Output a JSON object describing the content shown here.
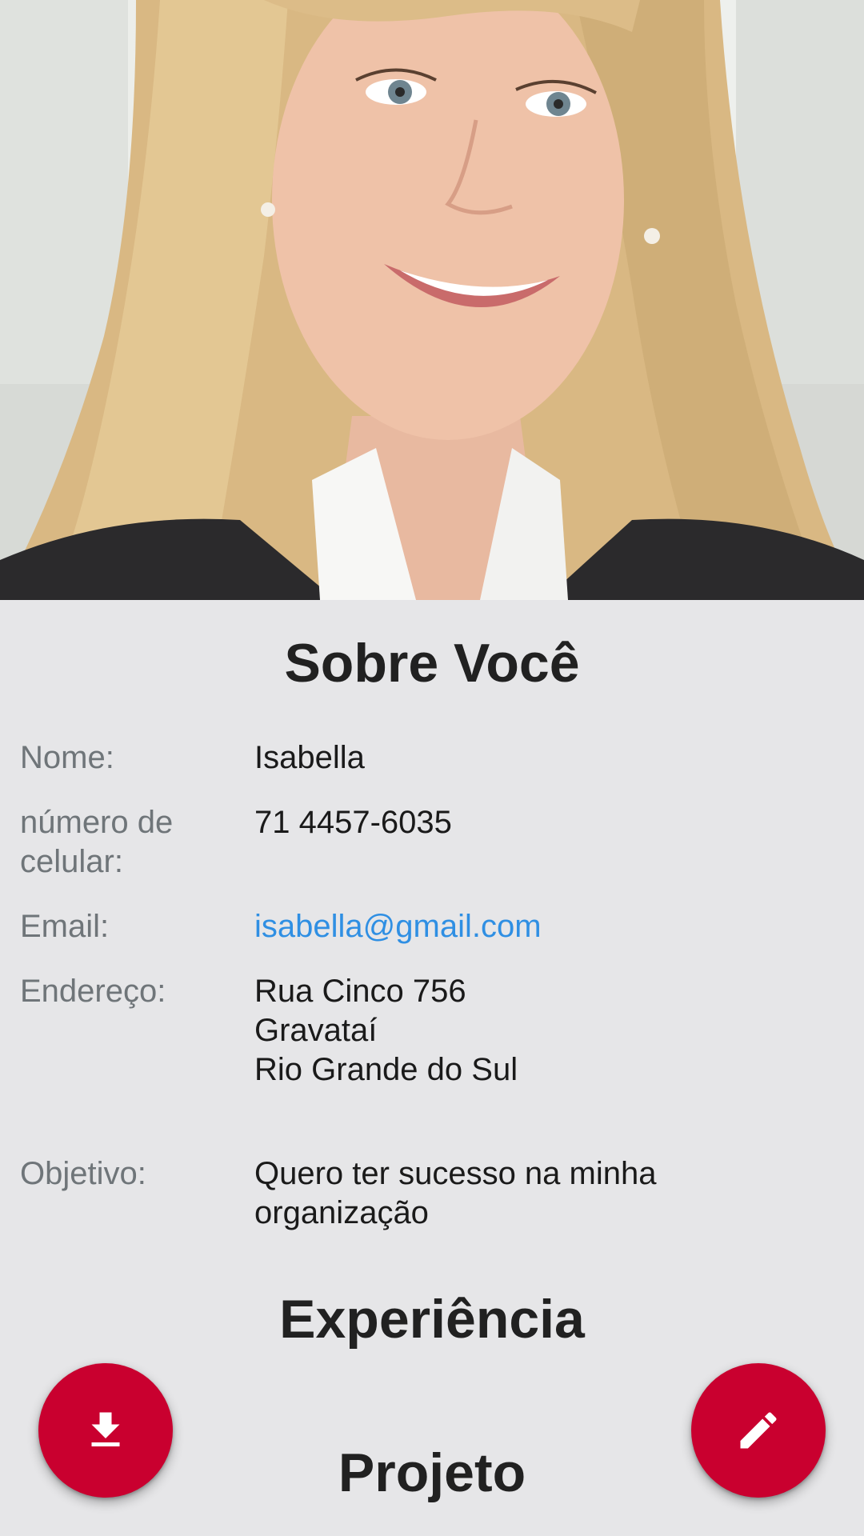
{
  "profile": {
    "photo_icon": "profile-photo"
  },
  "about": {
    "title": "Sobre Você",
    "fields": [
      {
        "label": "Nome:",
        "value": "Isabella"
      },
      {
        "label": "número de\ncelular:",
        "value": "71 4457-6035"
      },
      {
        "label": "Email:",
        "value": "isabella@gmail.com"
      },
      {
        "label": "Endereço:",
        "value": "Rua Cinco 756\nGravataí\nRio Grande do Sul"
      },
      {
        "label": "Objetivo:",
        "value": "Quero ter sucesso na minha\norganização"
      }
    ]
  },
  "experience": {
    "title": "Experiência"
  },
  "project": {
    "title": "Projeto"
  },
  "actions": {
    "download_icon": "download-icon",
    "edit_icon": "edit-icon"
  },
  "colors": {
    "background": "#e6e6e8",
    "fab": "#c9002f",
    "link": "#2f8fe3",
    "label": "#6f7579"
  }
}
